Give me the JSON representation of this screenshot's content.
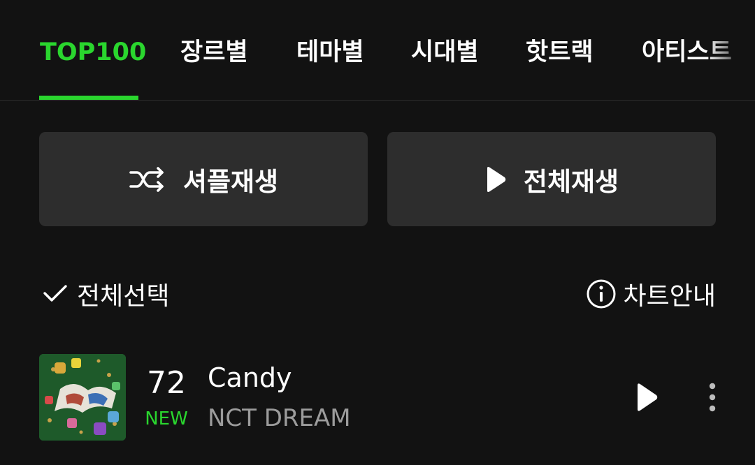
{
  "tabs": [
    {
      "label": "TOP100",
      "active": true
    },
    {
      "label": "장르별",
      "active": false
    },
    {
      "label": "테마별",
      "active": false
    },
    {
      "label": "시대별",
      "active": false
    },
    {
      "label": "핫트랙",
      "active": false
    },
    {
      "label": "아티스트",
      "active": false
    }
  ],
  "actions": {
    "shuffle_label": "셔플재생",
    "play_all_label": "전체재생",
    "select_all_label": "전체선택",
    "chart_info_label": "차트안내"
  },
  "songs": [
    {
      "rank": "72",
      "status": "NEW",
      "title": "Candy",
      "artist": "NCT DREAM",
      "album_art_icon": "album-cover"
    }
  ],
  "colors": {
    "background": "#121212",
    "accent": "#2ad62e",
    "button_bg": "#2d2d2d",
    "secondary_text": "#9c9c9c"
  }
}
